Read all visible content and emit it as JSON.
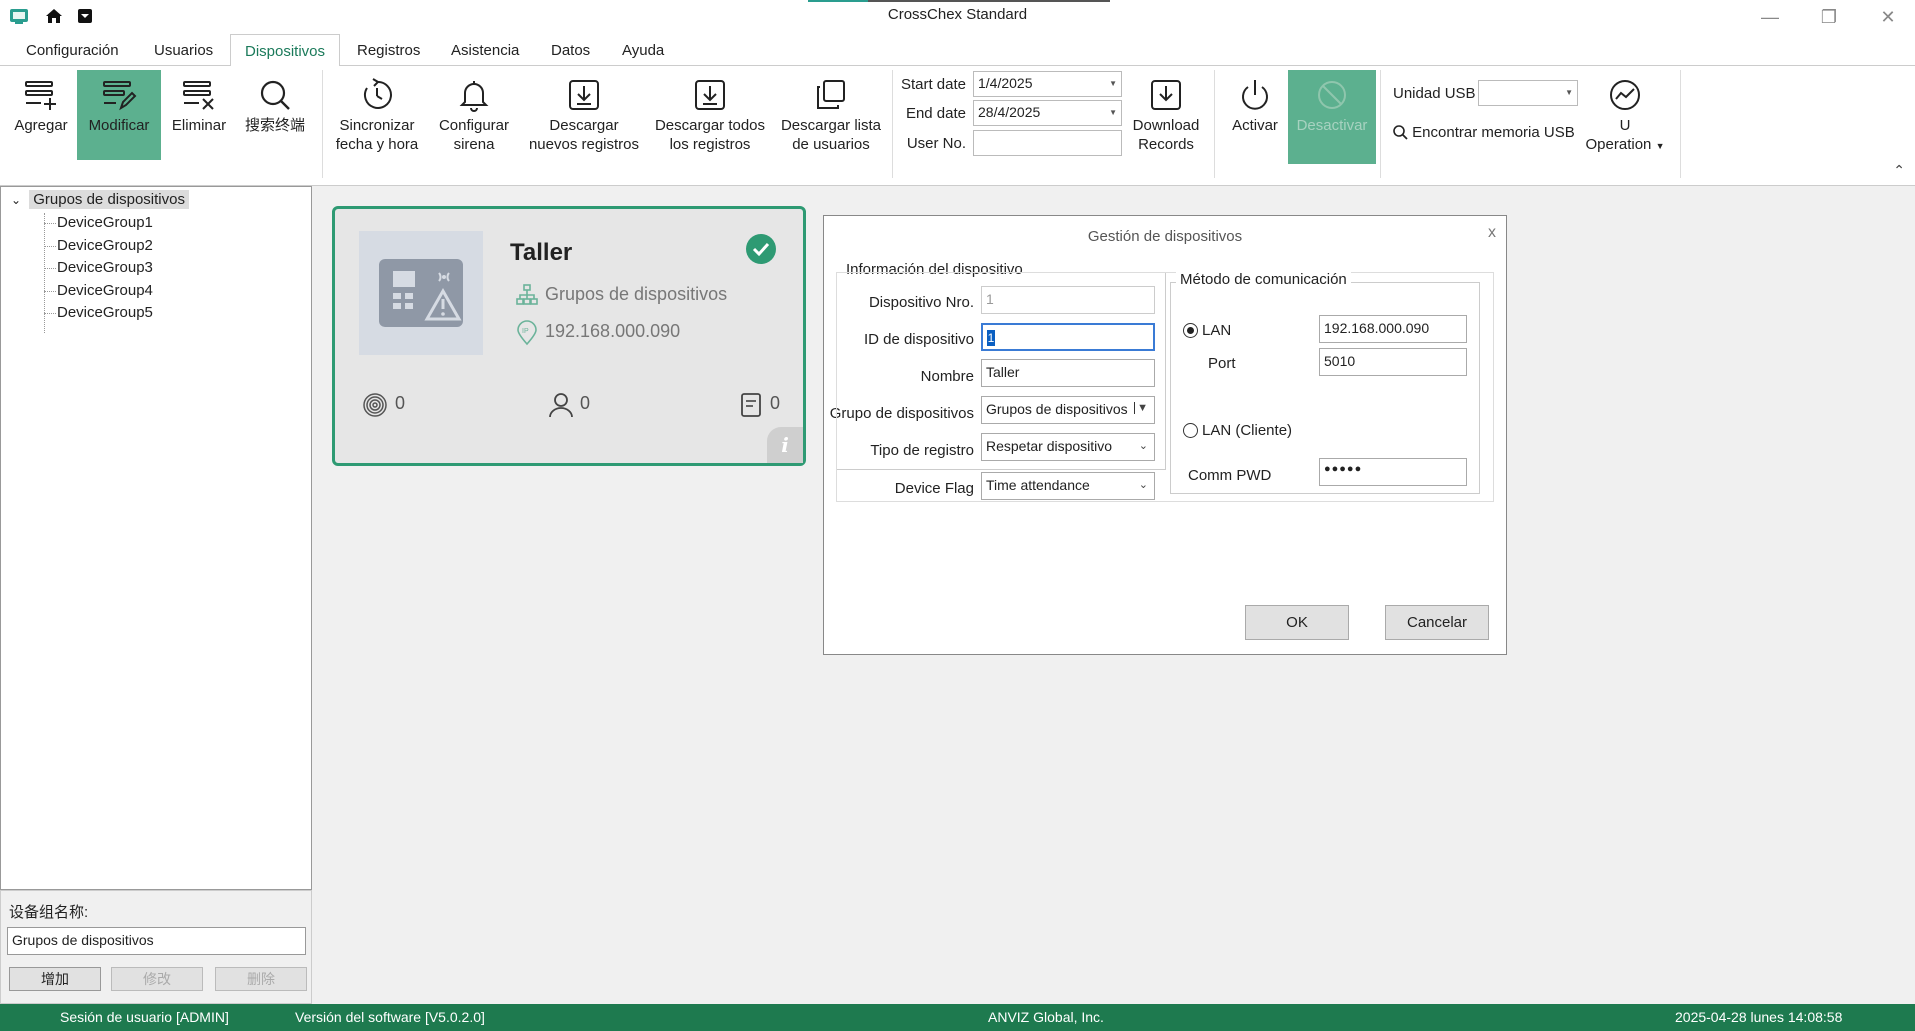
{
  "window": {
    "title": "CrossChex Standard"
  },
  "menu": {
    "tabs": [
      {
        "label": "Configuración"
      },
      {
        "label": "Usuarios"
      },
      {
        "label": "Dispositivos"
      },
      {
        "label": "Registros"
      },
      {
        "label": "Asistencia"
      },
      {
        "label": "Datos"
      },
      {
        "label": "Ayuda"
      }
    ]
  },
  "ribbon": {
    "add": "Agregar",
    "modify": "Modificar",
    "delete": "Eliminar",
    "search_terminal": "搜索终端",
    "sync_line1": "Sincronizar",
    "sync_line2": "fecha y hora",
    "siren_line1": "Configurar",
    "siren_line2": "sirena",
    "dl_new_line1": "Descargar",
    "dl_new_line2": "nuevos registros",
    "dl_all_line1": "Descargar todos",
    "dl_all_line2": "los registros",
    "dl_users_line1": "Descargar lista",
    "dl_users_line2": "de usuarios",
    "start_date_label": "Start date",
    "start_date_value": "1/4/2025",
    "end_date_label": "End date",
    "end_date_value": "28/4/2025",
    "user_no_label": "User No.",
    "user_no_value": "",
    "download_records_line1": "Download",
    "download_records_line2": "Records",
    "activate": "Activar",
    "deactivate": "Desactivar",
    "usb_unit_label": "Unidad USB",
    "find_usb": "Encontrar memoria USB",
    "u_operation_line1": "U",
    "u_operation_line2": "Operation"
  },
  "tree": {
    "root": "Grupos de dispositivos",
    "items": [
      "DeviceGroup1",
      "DeviceGroup2",
      "DeviceGroup3",
      "DeviceGroup4",
      "DeviceGroup5"
    ]
  },
  "group_panel": {
    "label": "设备组名称:",
    "value": "Grupos de dispositivos",
    "add": "增加",
    "edit": "修改",
    "delete": "删除"
  },
  "card": {
    "name": "Taller",
    "group": "Grupos de dispositivos",
    "ip": "192.168.000.090",
    "fingerprints": "0",
    "users": "0",
    "records": "0",
    "info": "i"
  },
  "dialog": {
    "title": "Gestión de dispositivos",
    "close": "x",
    "device_info_legend": "Información del dispositivo",
    "device_no_label": "Dispositivo Nro.",
    "device_no_value": "1",
    "device_id_label": "ID de dispositivo",
    "device_id_value": "1",
    "name_label": "Nombre",
    "name_value": "Taller",
    "group_label": "Grupo de dispositivos",
    "group_value": "Grupos de dispositivos",
    "record_type_label": "Tipo de registro",
    "record_type_value": "Respetar dispositivo",
    "device_flag_label": "Device Flag",
    "device_flag_value": "Time attendance",
    "comm_legend": "Método de comunicación",
    "lan_label": "LAN",
    "lan_ip_value": "192.168.000.090",
    "port_label": "Port",
    "port_value": "5010",
    "lan_client_label": "LAN (Cliente)",
    "comm_pwd_label": "Comm PWD",
    "comm_pwd_value": "●●●●●",
    "ok": "OK",
    "cancel": "Cancelar"
  },
  "status": {
    "session": "Sesión de usuario  [ADMIN]",
    "version": "Versión del software  [V5.0.2.0]",
    "company": "ANVIZ Global, Inc.",
    "datetime": "2025-04-28 lunes 14:08:58"
  },
  "colors": {
    "accent_green": "#2e9a73",
    "active_button": "#5cb08f",
    "status_bar": "#1e7a4f"
  }
}
